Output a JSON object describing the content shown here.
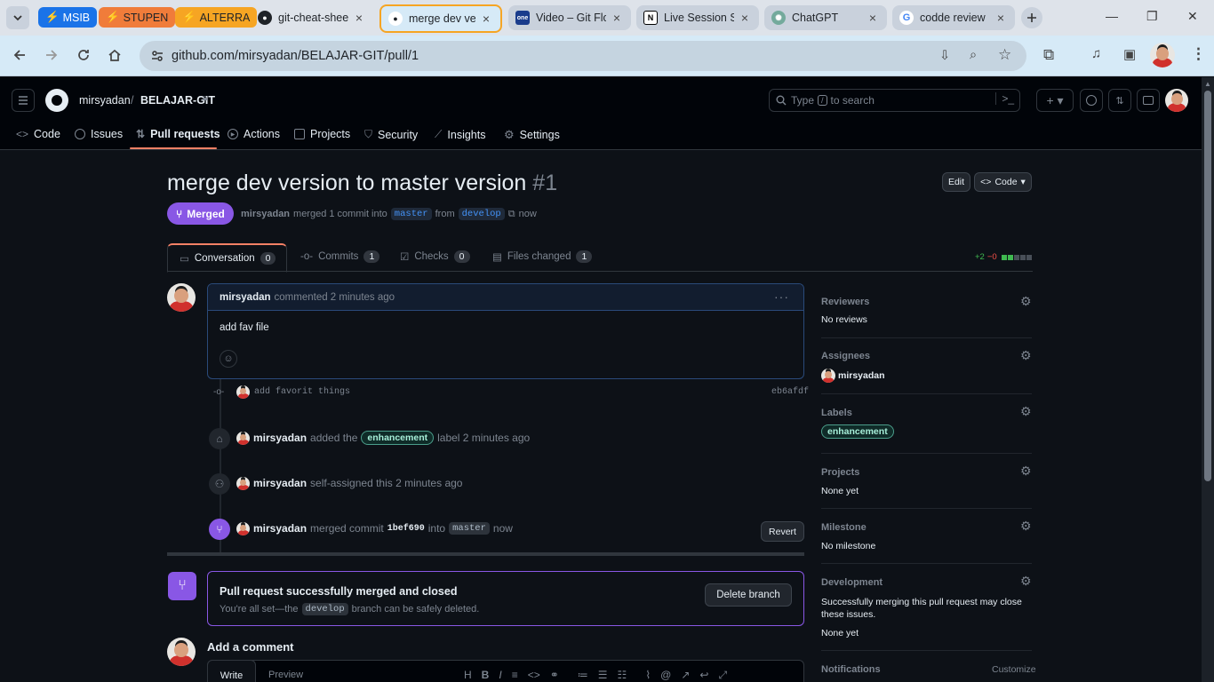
{
  "browser": {
    "tab_groups": [
      {
        "label": "MSIB",
        "color": "#1a73e8"
      },
      {
        "label": "STUPEN",
        "color": "#f07c3a"
      },
      {
        "label": "ALTERRA",
        "color": "#f6a523"
      }
    ],
    "tabs": [
      {
        "title": "git-cheat-sheet",
        "icon": "github-icon"
      },
      {
        "title": "merge dev version",
        "icon": "github-icon",
        "active": true
      },
      {
        "title": "Video – Git Flow",
        "icon": "one-icon"
      },
      {
        "title": "Live Session S",
        "icon": "notion-icon"
      },
      {
        "title": "ChatGPT",
        "icon": "chatgpt-icon"
      },
      {
        "title": "codde review",
        "icon": "google-icon"
      }
    ],
    "url": "github.com/mirsyadan/BELAJAR-GIT/pull/1"
  },
  "repo": {
    "owner": "mirsyadan",
    "separator": "/",
    "name": "BELAJAR-GIT"
  },
  "search": {
    "placeholder_pre": "Type",
    "key": "/",
    "placeholder_post": "to search"
  },
  "nav": [
    {
      "label": "Code",
      "icon": "code-icon"
    },
    {
      "label": "Issues",
      "icon": "issue-icon"
    },
    {
      "label": "Pull requests",
      "icon": "pull-request-icon",
      "active": true
    },
    {
      "label": "Actions",
      "icon": "play-icon"
    },
    {
      "label": "Projects",
      "icon": "table-icon"
    },
    {
      "label": "Security",
      "icon": "shield-icon"
    },
    {
      "label": "Insights",
      "icon": "graph-icon"
    },
    {
      "label": "Settings",
      "icon": "gear-icon"
    }
  ],
  "pr": {
    "title": "merge dev version to master version",
    "number": "#1",
    "status": "Merged",
    "summary_user": "mirsyadan",
    "summary_text": "merged 1 commit into",
    "base": "master",
    "from_text": "from",
    "head": "develop",
    "time": "now",
    "edit_label": "Edit",
    "code_label": "Code",
    "tabs": [
      {
        "label": "Conversation",
        "count": "0",
        "icon": "comment-icon"
      },
      {
        "label": "Commits",
        "count": "1",
        "icon": "commit-icon"
      },
      {
        "label": "Checks",
        "count": "0",
        "icon": "checklist-icon"
      },
      {
        "label": "Files changed",
        "count": "1",
        "icon": "file-diff-icon"
      }
    ],
    "additions": "+2",
    "deletions": "−0",
    "status_color": "#8957e5"
  },
  "comment": {
    "author": "mirsyadan",
    "meta": "commented 2 minutes ago",
    "body": "add fav file"
  },
  "timeline": {
    "commit_msg": "add favorit things",
    "commit_sha": "eb6afdf",
    "label_event": {
      "user": "mirsyadan",
      "pre": "added the",
      "label": "enhancement",
      "post": "label 2 minutes ago"
    },
    "assign_event": {
      "user": "mirsyadan",
      "text": "self-assigned this 2 minutes ago"
    },
    "merge_event": {
      "user": "mirsyadan",
      "pre": "merged commit",
      "sha": "1bef690",
      "mid": "into",
      "branch": "master",
      "time": "now",
      "revert_label": "Revert"
    }
  },
  "merged_box": {
    "title": "Pull request successfully merged and closed",
    "desc_pre": "You're all set—the",
    "branch": "develop",
    "desc_post": "branch can be safely deleted.",
    "delete_label": "Delete branch"
  },
  "add_comment": {
    "heading": "Add a comment",
    "write": "Write",
    "preview": "Preview"
  },
  "sidebar": {
    "reviewers": {
      "title": "Reviewers",
      "value": "No reviews"
    },
    "assignees": {
      "title": "Assignees",
      "value": "mirsyadan"
    },
    "labels": {
      "title": "Labels",
      "value": "enhancement"
    },
    "projects": {
      "title": "Projects",
      "value": "None yet"
    },
    "milestone": {
      "title": "Milestone",
      "value": "No milestone"
    },
    "development": {
      "title": "Development",
      "desc": "Successfully merging this pull request may close these issues.",
      "value": "None yet"
    },
    "notifications": {
      "title": "Notifications",
      "action": "Customize"
    }
  }
}
